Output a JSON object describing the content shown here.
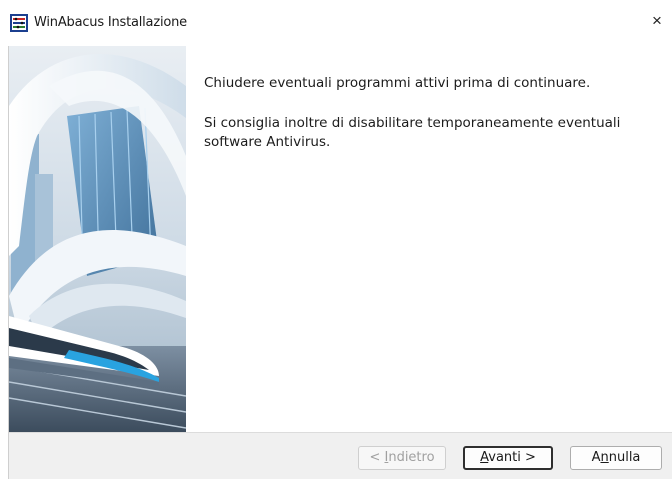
{
  "window": {
    "title": "WinAbacus Installazione",
    "close_glyph": "×",
    "icon": "winabacus-app-icon"
  },
  "main": {
    "message_1": "Chiudere eventuali programmi attivi prima di continuare.",
    "message_2": "Si consiglia inoltre di disabilitare temporaneamente eventuali software Antivirus."
  },
  "buttons": {
    "back": {
      "prefix": "< ",
      "accel": "I",
      "rest": "ndietro",
      "enabled": false
    },
    "next": {
      "accel": "A",
      "rest": "vanti >",
      "enabled": true,
      "default": true
    },
    "cancel": {
      "prefix": "A",
      "accel": "n",
      "rest": "nulla",
      "enabled": true
    }
  },
  "colors": {
    "accent_sky": "#8fc4e6",
    "structure_white": "#eef3f7",
    "glass_blue": "#5f8fb8",
    "footer_bg": "#f0f0f0"
  }
}
